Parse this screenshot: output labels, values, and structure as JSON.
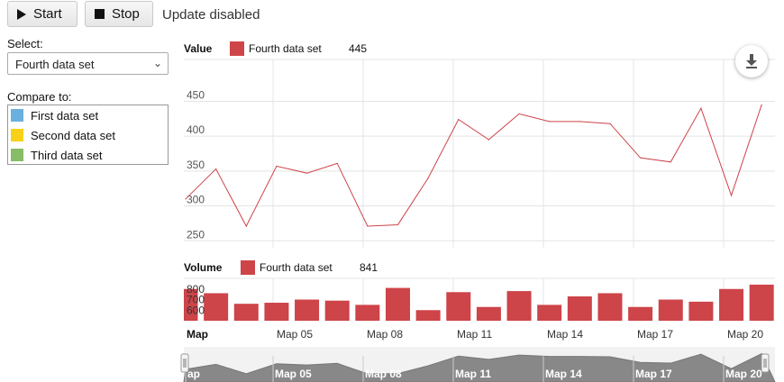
{
  "toolbar": {
    "start_label": "Start",
    "stop_label": "Stop",
    "status": "Update disabled"
  },
  "select": {
    "label": "Select:",
    "value": "Fourth data set"
  },
  "compare": {
    "label": "Compare to:",
    "items": [
      {
        "label": "First data set",
        "color": "#6ab0de"
      },
      {
        "label": "Second data set",
        "color": "#f7d117"
      },
      {
        "label": "Third data set",
        "color": "#86bd66"
      }
    ]
  },
  "colors": {
    "series": "#cd4449",
    "grid": "#e4e4e4",
    "navigator_area": "#888888"
  },
  "icons": {
    "download": "download-icon",
    "start": "play-icon",
    "stop": "stop-icon"
  },
  "chart_data": [
    {
      "type": "line",
      "panel_label": "Value",
      "legend": {
        "name": "Fourth data set",
        "value": "445"
      },
      "ylim": [
        240,
        510
      ],
      "yticks": [
        250,
        300,
        350,
        400,
        450
      ],
      "x_ticks": [
        "Map 05",
        "Map 08",
        "Map 11",
        "Map 14",
        "Map 17",
        "Map 20"
      ],
      "x_labels_axis": "Map",
      "series": [
        {
          "name": "Fourth data set",
          "values": [
            310,
            353,
            271,
            357,
            347,
            361,
            271,
            273,
            340,
            424,
            395,
            432,
            421,
            421,
            418,
            369,
            363,
            440,
            315,
            445
          ]
        }
      ]
    },
    {
      "type": "bar",
      "panel_label": "Volume",
      "legend": {
        "name": "Fourth data set",
        "value": "841"
      },
      "ylim": [
        500,
        900
      ],
      "yticks": [
        600,
        700,
        800
      ],
      "series": [
        {
          "name": "Fourth data set",
          "values": [
            800,
            760,
            660,
            670,
            700,
            690,
            650,
            810,
            600,
            770,
            630,
            780,
            650,
            730,
            760,
            630,
            700,
            680,
            800,
            841
          ]
        }
      ]
    },
    {
      "type": "area",
      "panel_label": "navigator",
      "x_ticks": [
        "ap",
        "Map 05",
        "Map 08",
        "Map 11",
        "Map 14",
        "Map 17",
        "Map 20"
      ]
    }
  ]
}
